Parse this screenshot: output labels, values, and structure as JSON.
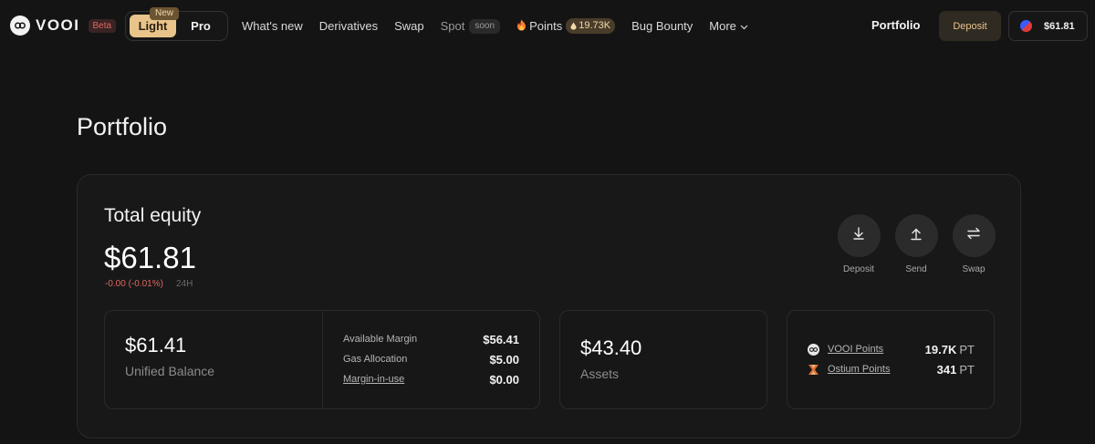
{
  "nav": {
    "brand": "VOOI",
    "beta": "Beta",
    "mode_light": "Light",
    "mode_pro": "Pro",
    "new_badge": "New",
    "links": {
      "whats_new": "What's new",
      "derivatives": "Derivatives",
      "swap": "Swap",
      "spot": "Spot",
      "spot_badge": "soon",
      "points": "Points",
      "points_value": "19.73K",
      "bug_bounty": "Bug Bounty",
      "more": "More"
    },
    "portfolio": "Portfolio",
    "deposit": "Deposit",
    "wallet_balance": "$61.81"
  },
  "page": {
    "title": "Portfolio"
  },
  "equity": {
    "label": "Total equity",
    "value": "$61.81",
    "change": "-0.00 (-0.01%)",
    "period": "24H",
    "actions": {
      "deposit": "Deposit",
      "send": "Send",
      "swap": "Swap"
    }
  },
  "balance": {
    "value": "$61.41",
    "label": "Unified Balance",
    "rows": [
      {
        "label": "Available Margin",
        "value": "$56.41"
      },
      {
        "label": "Gas Allocation",
        "value": "$5.00"
      },
      {
        "label": "Margin-in-use",
        "value": "$0.00"
      }
    ]
  },
  "assets": {
    "value": "$43.40",
    "label": "Assets"
  },
  "points": {
    "rows": [
      {
        "name": "VOOI Points",
        "value": "19.7K",
        "unit": "PT"
      },
      {
        "name": "Ostium Points",
        "value": "341",
        "unit": "PT"
      }
    ]
  },
  "colors": {
    "background": "#141414",
    "accent": "#e8c48a",
    "negative": "#e0665e"
  }
}
